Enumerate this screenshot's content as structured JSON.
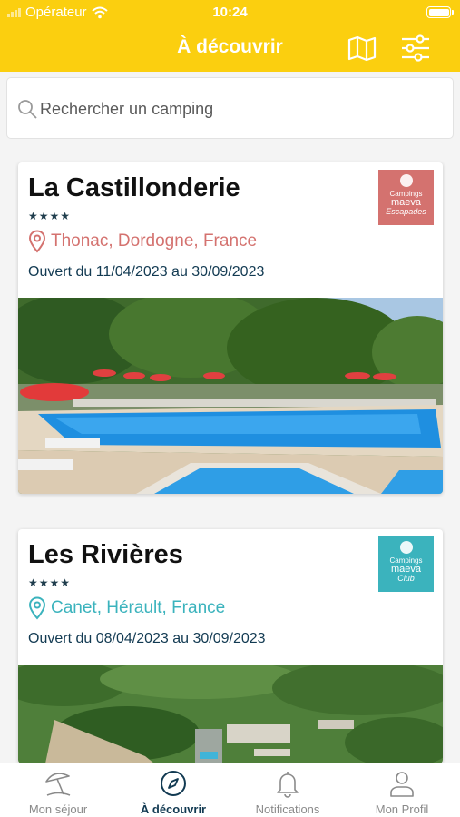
{
  "status_bar": {
    "carrier": "Opérateur",
    "time": "10:24"
  },
  "header": {
    "title": "À découvrir",
    "map_icon": "map-icon",
    "filter_icon": "filter-icon",
    "bg_color": "#fbcf0f"
  },
  "search": {
    "placeholder": "Rechercher un camping",
    "value": ""
  },
  "campings": [
    {
      "name": "La Castillonderie",
      "stars": "★★★★",
      "location": "Thonac, Dordogne, France",
      "dates": "Ouvert du 11/04/2023 au 30/09/2023",
      "badge": {
        "line1": "Campings",
        "line2": "maeva",
        "line3": "Escapades",
        "color": "#d4726f"
      },
      "accent": "#d4726f"
    },
    {
      "name": "Les Rivières",
      "stars": "★★★★",
      "location": "Canet, Hérault, France",
      "dates": "Ouvert du 08/04/2023 au 30/09/2023",
      "badge": {
        "line1": "Campings",
        "line2": "maeva",
        "line3": "Club",
        "color": "#3bb3bd"
      },
      "accent": "#3bb3bd"
    }
  ],
  "tabs": [
    {
      "label": "Mon séjour",
      "icon": "beach-umbrella-icon"
    },
    {
      "label": "À découvrir",
      "icon": "compass-icon"
    },
    {
      "label": "Notifications",
      "icon": "bell-icon"
    },
    {
      "label": "Mon Profil",
      "icon": "user-icon"
    }
  ]
}
